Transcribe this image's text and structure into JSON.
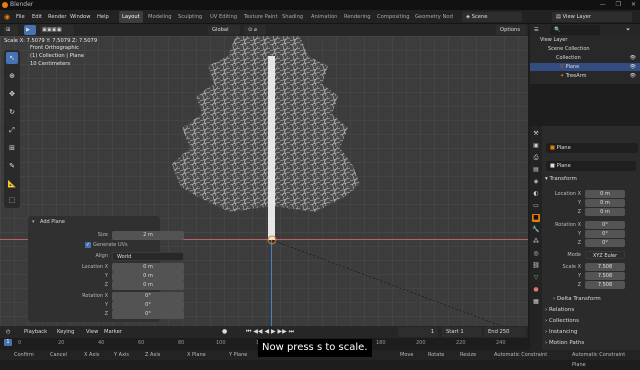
{
  "app": {
    "title": "Blender"
  },
  "window_controls": [
    "—",
    "❐",
    "✕"
  ],
  "menu": [
    "File",
    "Edit",
    "Render",
    "Window",
    "Help"
  ],
  "workspaces": [
    "Layout",
    "Modeling",
    "Sculpting",
    "UV Editing",
    "Texture Paint",
    "Shading",
    "Animation",
    "Rendering",
    "Compositing",
    "Geometry Nod"
  ],
  "scene": {
    "name": "Scene"
  },
  "view_layer": {
    "name": "View Layer"
  },
  "viewport": {
    "header": {
      "orientation": "Global",
      "options": "Options"
    },
    "scale_readout": "Scale X: 7.5079  Y: 7.5079  Z: 7.5079",
    "overlay_text": [
      "Front Orthographic",
      "(1) Collection | Plane",
      "10 Centimeters"
    ]
  },
  "add_plane": {
    "title": "Add Plane",
    "size_label": "Size",
    "size_value": "2 m",
    "generate_uvs_label": "Generate UVs",
    "align_label": "Align",
    "align_value": "World",
    "location_label": "Location X",
    "loc_x": "0 m",
    "loc_y": "0 m",
    "loc_z": "0 m",
    "rotation_label": "Rotation X",
    "rot_x": "0°",
    "rot_y": "0°",
    "rot_z": "0°",
    "y_label": "Y",
    "z_label": "Z"
  },
  "timeline": {
    "playback": "Playback",
    "keying": "Keying",
    "view": "View",
    "marker": "Marker",
    "current_frame": "1",
    "start_label": "Start",
    "start": "1",
    "end_label": "End",
    "end": "250",
    "ticks": [
      "0",
      "20",
      "40",
      "60",
      "80",
      "100",
      "120",
      "140",
      "160",
      "180",
      "200",
      "220",
      "240"
    ]
  },
  "statusbar": {
    "items": [
      "Confirm",
      "Cancel",
      "X Axis",
      "Y Axis",
      "Z Axis",
      "X Plane",
      "Y Plane",
      "Z Plane",
      "Clear Constraints",
      "Snap Invert",
      "Snap Toggle",
      "Move",
      "Rotate",
      "Resize",
      "Automatic Constraint",
      "Automatic Constraint Plane"
    ]
  },
  "outliner": {
    "rows": [
      "Scene Collection",
      "Collection",
      "Plane",
      "TreeArm"
    ]
  },
  "properties": {
    "object_name": "Plane",
    "data_name": "Plane",
    "transform_label": "Transform",
    "location_label": "Location X",
    "loc": [
      "0 m",
      "0 m",
      "0 m"
    ],
    "rotation_label": "Rotation X",
    "rot": [
      "0°",
      "0°",
      "0°"
    ],
    "mode_label": "Mode",
    "mode_value": "XYZ Euler",
    "scale_label": "Scale X",
    "scale": [
      "7.508",
      "7.508",
      "7.508"
    ],
    "y_label": "Y",
    "z_label": "Z",
    "sections": [
      "Delta Transform",
      "Relations",
      "Collections",
      "Instancing",
      "Motion Paths"
    ]
  },
  "subtitle": "Now press s to scale.",
  "colors": {
    "accent": "#4772b3",
    "x_axis": "#c05e6a",
    "y_axis": "#4a7cc9",
    "orange": "#e87d0d"
  }
}
